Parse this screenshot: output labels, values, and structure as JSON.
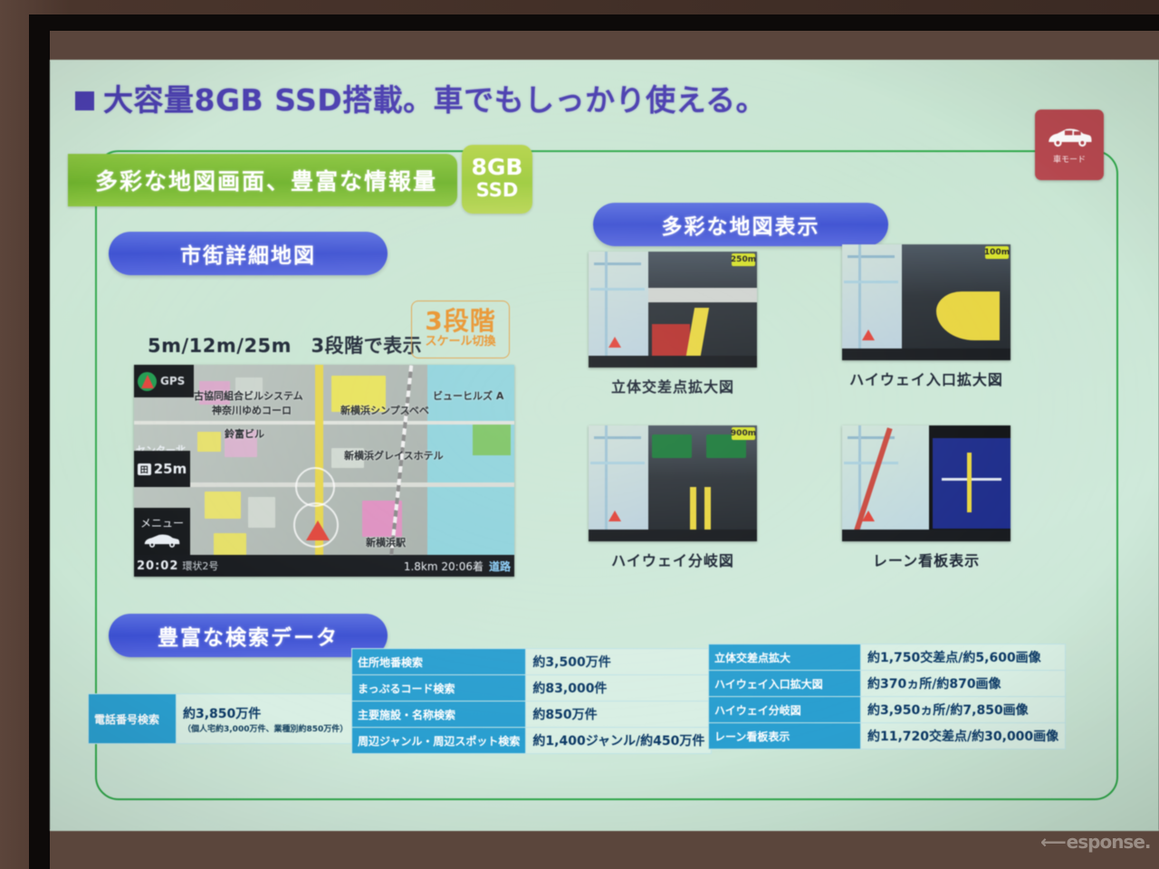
{
  "slide": {
    "title": {
      "bullet": "■",
      "text": "大容量8GB SSD搭載。車でもしっかり使える。"
    },
    "car_mode_badge": {
      "label": "車モード",
      "icon": "car-icon",
      "color": "#b7484f"
    },
    "banner": {
      "text": "多彩な地図画面、豊富な情報量",
      "color": "#7fbf35"
    },
    "ssd_badge": {
      "line1": "8GB",
      "line2": "SSD",
      "color": "#a9cf43"
    },
    "sections": {
      "city_map": {
        "pill": "市街詳細地図",
        "scale_text": "5m/12m/25m　3段階で表示",
        "step_badge": {
          "line1": "3段階",
          "line2": "スケール切換",
          "color": "#e8922a"
        },
        "screenshot": {
          "gps_label": "GPS",
          "scale_label": "25m",
          "scale_icon": "map-icon",
          "menu_label": "メニュー",
          "menu_icon": "car-icon",
          "center_label": "センター北",
          "pois": [
            "古協同組合ビルシステム",
            "神奈川ゆめコーロ",
            "鈴富ビル",
            "新横浜シンプスベベ",
            "ビューヒルズ A",
            "新横浜グレイスホテル",
            "新横浜駅"
          ],
          "status_time": "20:02",
          "status_road": "環状2号",
          "status_distance": "1.8km",
          "status_eta": "20:06着",
          "status_mode": "道路"
        }
      },
      "varied_maps": {
        "pill": "多彩な地図表示",
        "thumbnails": [
          {
            "caption": "立体交差点拡大図",
            "badge": "250m"
          },
          {
            "caption": "ハイウェイ入口拡大図",
            "badge": "100m"
          },
          {
            "caption": "ハイウェイ分岐図",
            "badge": "900m"
          },
          {
            "caption": "レーン看板表示",
            "badge": ""
          }
        ]
      },
      "search_data": {
        "pill": "豊富な検索データ",
        "phone_table": [
          {
            "key": "電話番号検索",
            "value": "約3,850万件",
            "sub": "（個人宅約3,000万件、業種別約850万件）"
          }
        ],
        "middle_table": [
          {
            "key": "住所地番検索",
            "value": "約3,500万件"
          },
          {
            "key": "まっぷるコード検索",
            "value": "約83,000件"
          },
          {
            "key": "主要施設・名称検索",
            "value": "約850万件"
          },
          {
            "key": "周辺ジャンル・周辺スポット検索",
            "value": "約1,400ジャンル/約450万件"
          }
        ],
        "right_table": [
          {
            "key": "立体交差点拡大",
            "value": "約1,750交差点/約5,600画像"
          },
          {
            "key": "ハイウェイ入口拡大図",
            "value": "約370ヵ所/約870画像"
          },
          {
            "key": "ハイウェイ分岐図",
            "value": "約3,950ヵ所/約7,850画像"
          },
          {
            "key": "レーン看板表示",
            "value": "約11,720交差点/約30,000画像"
          }
        ]
      }
    }
  },
  "watermark": {
    "text": "esponse."
  }
}
